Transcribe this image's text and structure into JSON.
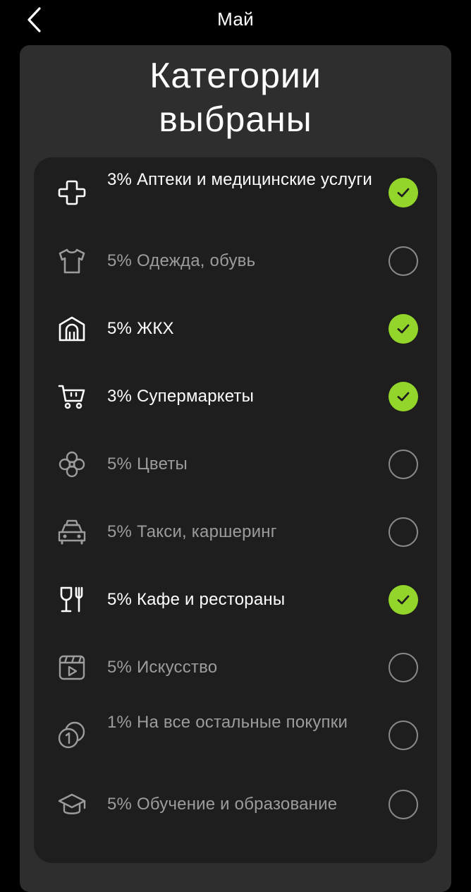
{
  "header": {
    "back_icon": "chevron-left-icon",
    "title": "Май"
  },
  "sheet": {
    "title": "Категории\nвыбраны"
  },
  "colors": {
    "background": "#000000",
    "sheet": "#2e2e2e",
    "card": "#1e1e1e",
    "accent": "#93d52b",
    "text_active": "#ffffff",
    "text_inactive": "#9c9c9c"
  },
  "categories": [
    {
      "label": "3% Аптеки и медицинские услуги",
      "icon": "medical-cross-icon",
      "selected": true
    },
    {
      "label": "5% Одежда, обувь",
      "icon": "tshirt-icon",
      "selected": false
    },
    {
      "label": "5% ЖКХ",
      "icon": "house-icon",
      "selected": true
    },
    {
      "label": "3% Супермаркеты",
      "icon": "shopping-cart-icon",
      "selected": true
    },
    {
      "label": "5% Цветы",
      "icon": "flower-icon",
      "selected": false
    },
    {
      "label": "5% Такси, каршеринг",
      "icon": "taxi-icon",
      "selected": false
    },
    {
      "label": "5% Кафе и рестораны",
      "icon": "wineglass-fork-icon",
      "selected": true
    },
    {
      "label": "5% Искусство",
      "icon": "video-clapper-icon",
      "selected": false
    },
    {
      "label": "1% На все остальные покупки",
      "icon": "coins-icon",
      "selected": false
    },
    {
      "label": "5% Обучение и образование",
      "icon": "graduation-cap-icon",
      "selected": false
    }
  ]
}
